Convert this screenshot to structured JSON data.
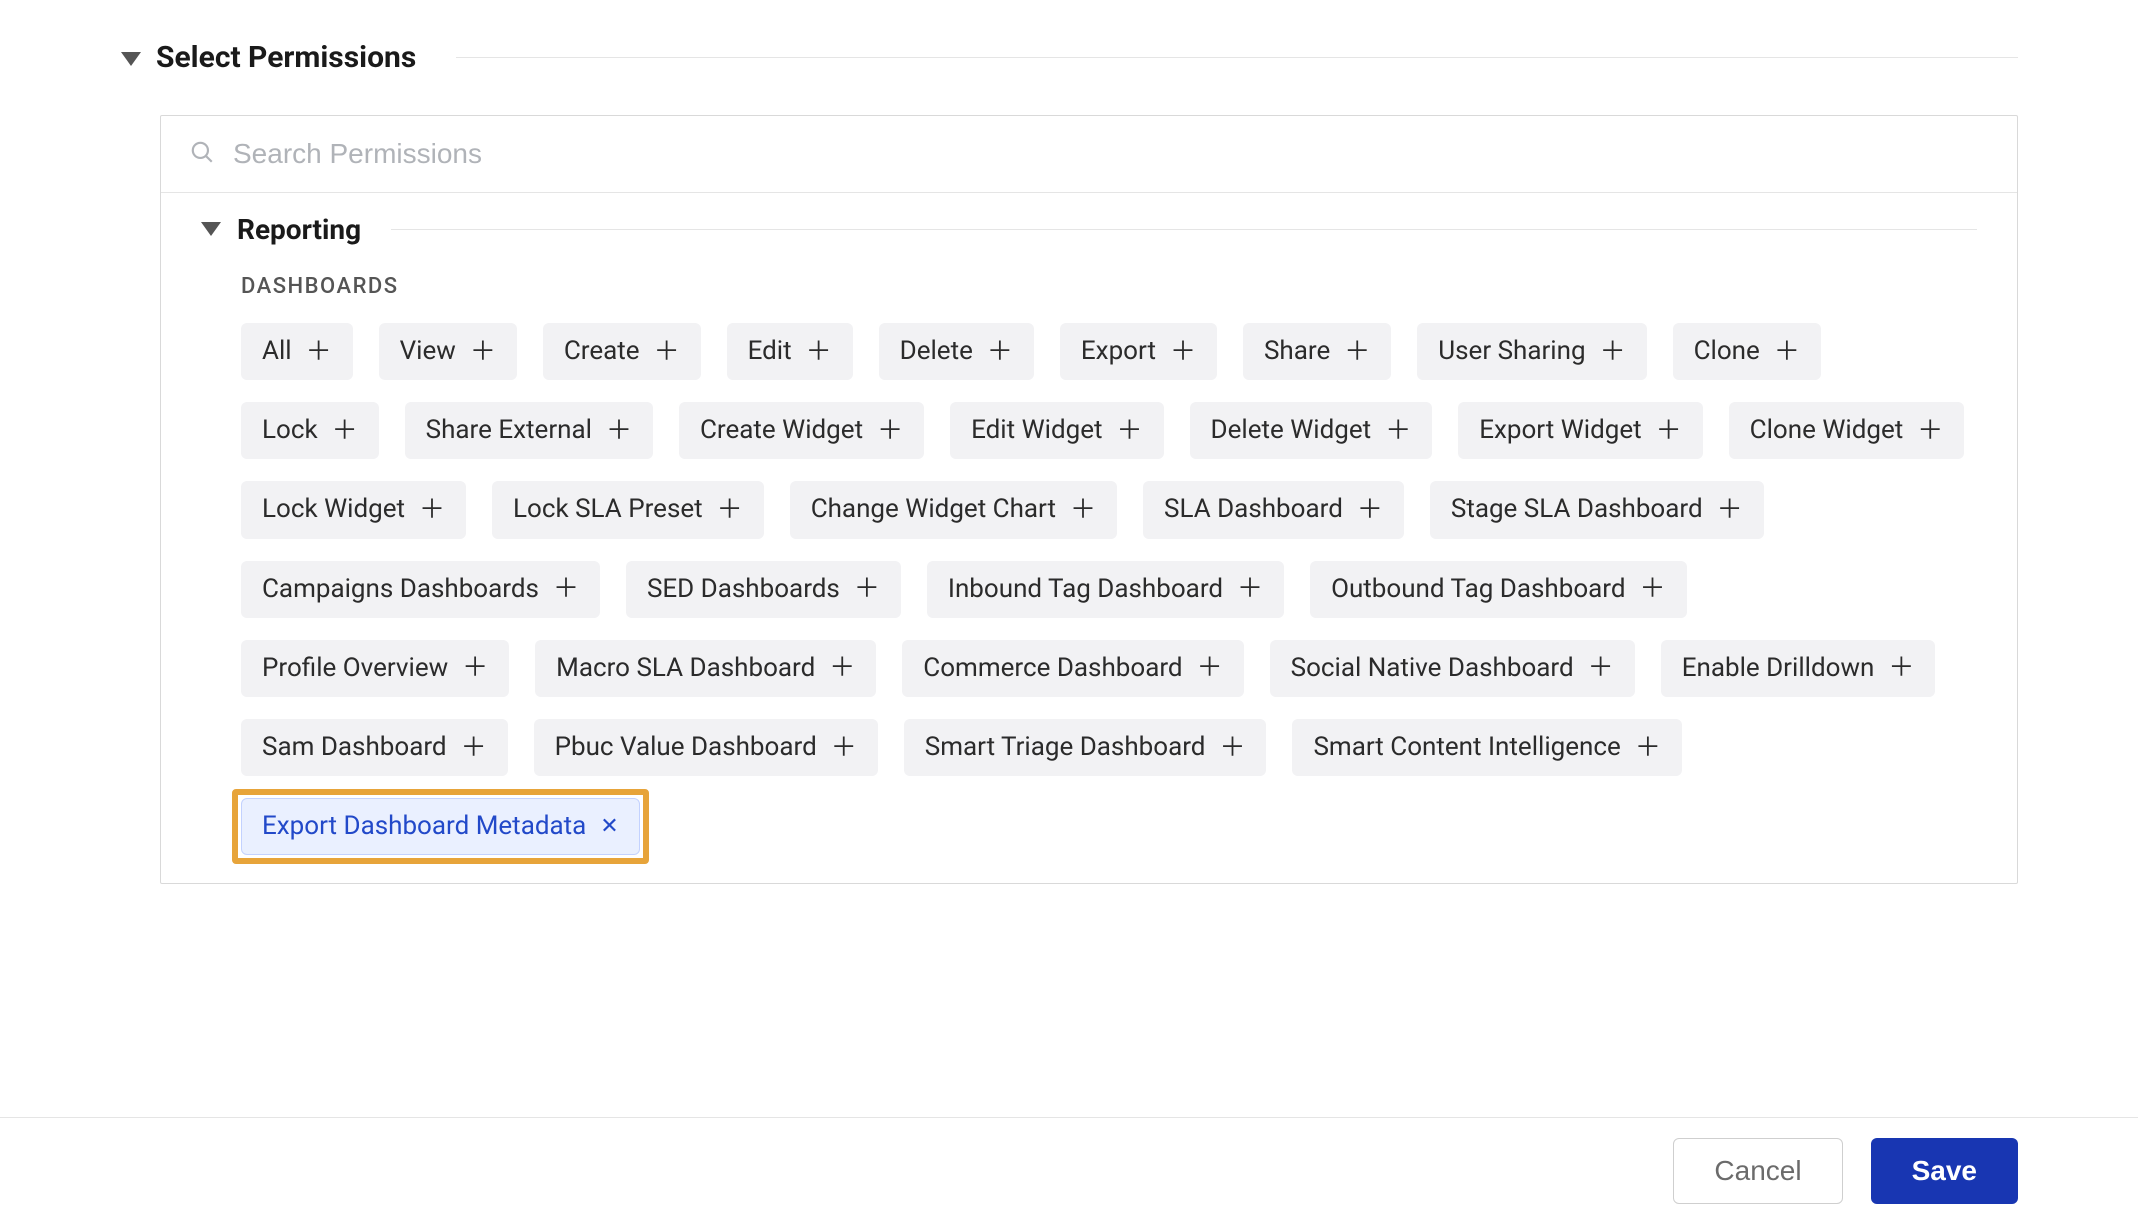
{
  "section_title": "Select Permissions",
  "search_placeholder": "Search Permissions",
  "group": {
    "title": "Reporting",
    "subgroup_title": "DASHBOARDS",
    "chips": [
      {
        "label": "All",
        "selected": false
      },
      {
        "label": "View",
        "selected": false
      },
      {
        "label": "Create",
        "selected": false
      },
      {
        "label": "Edit",
        "selected": false
      },
      {
        "label": "Delete",
        "selected": false
      },
      {
        "label": "Export",
        "selected": false
      },
      {
        "label": "Share",
        "selected": false
      },
      {
        "label": "User Sharing",
        "selected": false
      },
      {
        "label": "Clone",
        "selected": false
      },
      {
        "label": "Lock",
        "selected": false
      },
      {
        "label": "Share External",
        "selected": false
      },
      {
        "label": "Create Widget",
        "selected": false
      },
      {
        "label": "Edit Widget",
        "selected": false
      },
      {
        "label": "Delete Widget",
        "selected": false
      },
      {
        "label": "Export Widget",
        "selected": false
      },
      {
        "label": "Clone Widget",
        "selected": false
      },
      {
        "label": "Lock Widget",
        "selected": false
      },
      {
        "label": "Lock SLA Preset",
        "selected": false
      },
      {
        "label": "Change Widget Chart",
        "selected": false
      },
      {
        "label": "SLA Dashboard",
        "selected": false
      },
      {
        "label": "Stage SLA Dashboard",
        "selected": false
      },
      {
        "label": "Campaigns Dashboards",
        "selected": false
      },
      {
        "label": "SED Dashboards",
        "selected": false
      },
      {
        "label": "Inbound Tag Dashboard",
        "selected": false
      },
      {
        "label": "Outbound Tag Dashboard",
        "selected": false
      },
      {
        "label": "Profile Overview",
        "selected": false
      },
      {
        "label": "Macro SLA Dashboard",
        "selected": false
      },
      {
        "label": "Commerce Dashboard",
        "selected": false
      },
      {
        "label": "Social Native Dashboard",
        "selected": false
      },
      {
        "label": "Enable Drilldown",
        "selected": false
      },
      {
        "label": "Sam Dashboard",
        "selected": false
      },
      {
        "label": "Pbuc Value Dashboard",
        "selected": false
      },
      {
        "label": "Smart Triage Dashboard",
        "selected": false
      },
      {
        "label": "Smart Content Intelligence",
        "selected": false
      },
      {
        "label": "Export Dashboard Metadata",
        "selected": true,
        "highlighted": true
      }
    ]
  },
  "footer": {
    "cancel": "Cancel",
    "save": "Save"
  }
}
